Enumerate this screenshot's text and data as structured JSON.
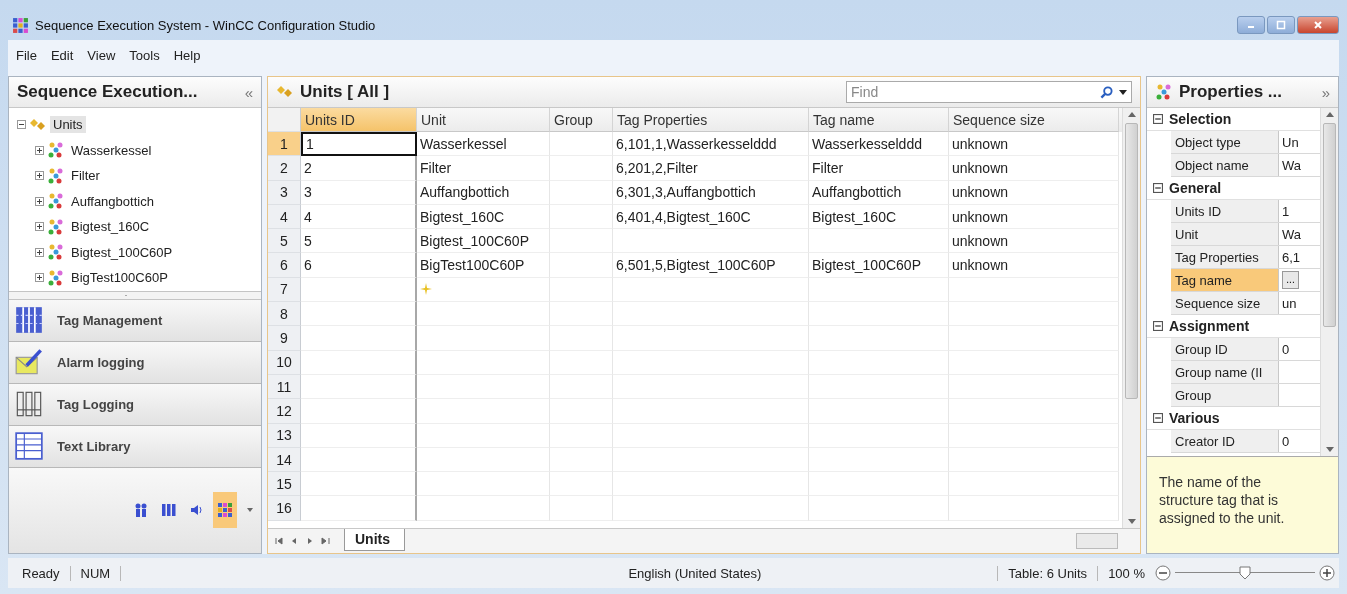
{
  "window": {
    "title": "Sequence Execution System - WinCC Configuration Studio"
  },
  "menu": [
    "File",
    "Edit",
    "View",
    "Tools",
    "Help"
  ],
  "navigation": {
    "title": "Sequence Execution...",
    "collapse": "«",
    "tree": [
      {
        "label": "Units",
        "kind": "folder",
        "expanded": true,
        "selected": true,
        "children": [
          {
            "label": "Wasserkessel",
            "kind": "unit",
            "expanded": false,
            "selected": false
          },
          {
            "label": "Filter",
            "kind": "unit",
            "expanded": false,
            "selected": false
          },
          {
            "label": "Auffangbottich",
            "kind": "unit",
            "expanded": false,
            "selected": false
          },
          {
            "label": "Bigtest_160C",
            "kind": "unit",
            "expanded": false,
            "selected": false
          },
          {
            "label": "Bigtest_100C60P",
            "kind": "unit",
            "expanded": false,
            "selected": false
          },
          {
            "label": "BigTest100C60P",
            "kind": "unit",
            "expanded": false,
            "selected": false
          }
        ]
      }
    ],
    "editors": [
      {
        "label": "Tag Management",
        "kind": "tags"
      },
      {
        "label": "Alarm logging",
        "kind": "alarm"
      },
      {
        "label": "Tag Logging",
        "kind": "logging"
      },
      {
        "label": "Text Library",
        "kind": "texts"
      }
    ],
    "mini_editors": [
      {
        "kind": "users",
        "selected": false
      },
      {
        "kind": "logging",
        "selected": false
      },
      {
        "kind": "sound",
        "selected": false
      },
      {
        "kind": "sequence",
        "selected": true
      }
    ]
  },
  "table": {
    "title": "Units [ All ]",
    "search": {
      "placeholder": "Find"
    },
    "columns": [
      {
        "label": "Units ID",
        "selected": true
      },
      {
        "label": "Unit",
        "selected": false
      },
      {
        "label": "Group",
        "selected": false
      },
      {
        "label": "Tag Properties",
        "selected": false
      },
      {
        "label": "Tag name",
        "selected": false
      },
      {
        "label": "Sequence size",
        "selected": false
      }
    ],
    "rows": [
      {
        "number": "1",
        "kind": "data",
        "selected": true,
        "cells": [
          "1",
          "Wasserkessel",
          null,
          "6,101,1,Wasserkesselddd",
          "Wasserkesselddd",
          "unknown"
        ]
      },
      {
        "number": "2",
        "kind": "data",
        "selected": false,
        "cells": [
          "2",
          "Filter",
          null,
          "6,201,2,Filter",
          "Filter",
          "unknown"
        ]
      },
      {
        "number": "3",
        "kind": "data",
        "selected": false,
        "cells": [
          "3",
          "Auffangbottich",
          null,
          "6,301,3,Auffangbottich",
          "Auffangbottich",
          "unknown"
        ]
      },
      {
        "number": "4",
        "kind": "data",
        "selected": false,
        "cells": [
          "4",
          "Bigtest_160C",
          null,
          "6,401,4,Bigtest_160C",
          "Bigtest_160C",
          "unknown"
        ]
      },
      {
        "number": "5",
        "kind": "data",
        "selected": false,
        "cells": [
          "5",
          "Bigtest_100C60P",
          null,
          null,
          null,
          "unknown"
        ]
      },
      {
        "number": "6",
        "kind": "data",
        "selected": false,
        "cells": [
          "6",
          "BigTest100C60P",
          null,
          "6,501,5,Bigtest_100C60P",
          "Bigtest_100C60P",
          "unknown"
        ]
      },
      {
        "number": "7",
        "kind": "new",
        "selected": false
      },
      {
        "number": "8",
        "kind": "empty",
        "selected": false
      },
      {
        "number": "9",
        "kind": "empty",
        "selected": false
      },
      {
        "number": "10",
        "kind": "empty",
        "selected": false
      },
      {
        "number": "11",
        "kind": "empty",
        "selected": false
      },
      {
        "number": "12",
        "kind": "empty",
        "selected": false
      },
      {
        "number": "13",
        "kind": "empty",
        "selected": false
      },
      {
        "number": "14",
        "kind": "empty",
        "selected": false
      },
      {
        "number": "15",
        "kind": "empty",
        "selected": false
      },
      {
        "number": "16",
        "kind": "empty",
        "selected": false
      }
    ],
    "sheet_tabs": [
      {
        "label": "Units",
        "selected": true
      }
    ]
  },
  "properties": {
    "title": "Properties ...",
    "expand": "»",
    "categories": [
      {
        "name": "Selection",
        "expanded": true,
        "items": [
          {
            "name": "Object type",
            "value": "Un",
            "selected": false
          },
          {
            "name": "Object name",
            "value": "Wa",
            "selected": false
          }
        ]
      },
      {
        "name": "General",
        "expanded": true,
        "items": [
          {
            "name": "Units ID",
            "value": "1",
            "selected": false
          },
          {
            "name": "Unit",
            "value": "Wa",
            "selected": false
          },
          {
            "name": "Tag Properties",
            "value": "6,1",
            "selected": false
          },
          {
            "name": "Tag name",
            "value": "...",
            "kind": "button",
            "selected": true
          },
          {
            "name": "Sequence size",
            "value": "un",
            "selected": false
          }
        ]
      },
      {
        "name": "Assignment",
        "expanded": true,
        "items": [
          {
            "name": "Group ID",
            "value": "0",
            "selected": false
          },
          {
            "name": "Group name (II",
            "selected": false
          },
          {
            "name": "Group",
            "selected": false
          }
        ]
      },
      {
        "name": "Various",
        "expanded": true,
        "items": [
          {
            "name": "Creator ID",
            "value": "0",
            "selected": false
          }
        ]
      }
    ],
    "description": "The name of the structure tag that is assigned to the unit."
  },
  "status_bar": {
    "state": "Ready",
    "num": "NUM",
    "language": "English (United States)",
    "table": "Table: 6 Units",
    "zoom": "100 %",
    "zoom_slider": {
      "level": 0.5
    }
  }
}
